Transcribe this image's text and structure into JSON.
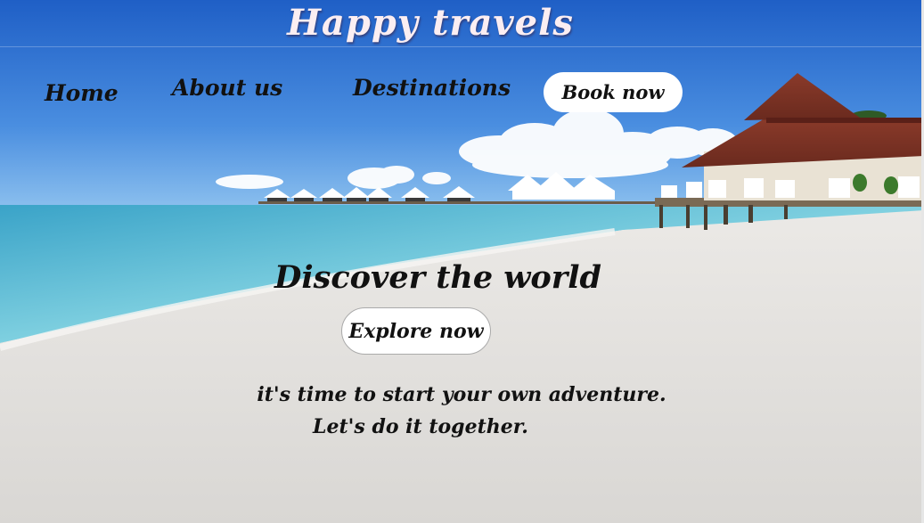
{
  "header": {
    "title": "Happy travels"
  },
  "nav": {
    "home": "Home",
    "about": "About us",
    "destinations": "Destinations",
    "book": "Book now"
  },
  "hero": {
    "heading": "Discover the world",
    "cta": "Explore now",
    "tagline_line1": "it's time to start your own adventure.",
    "tagline_line2": "Let's do it together."
  },
  "colors": {
    "sky": "#2e6fd0",
    "sea": "#5fb8d6",
    "sand": "#e9e7e4",
    "button_bg": "#ffffff"
  }
}
